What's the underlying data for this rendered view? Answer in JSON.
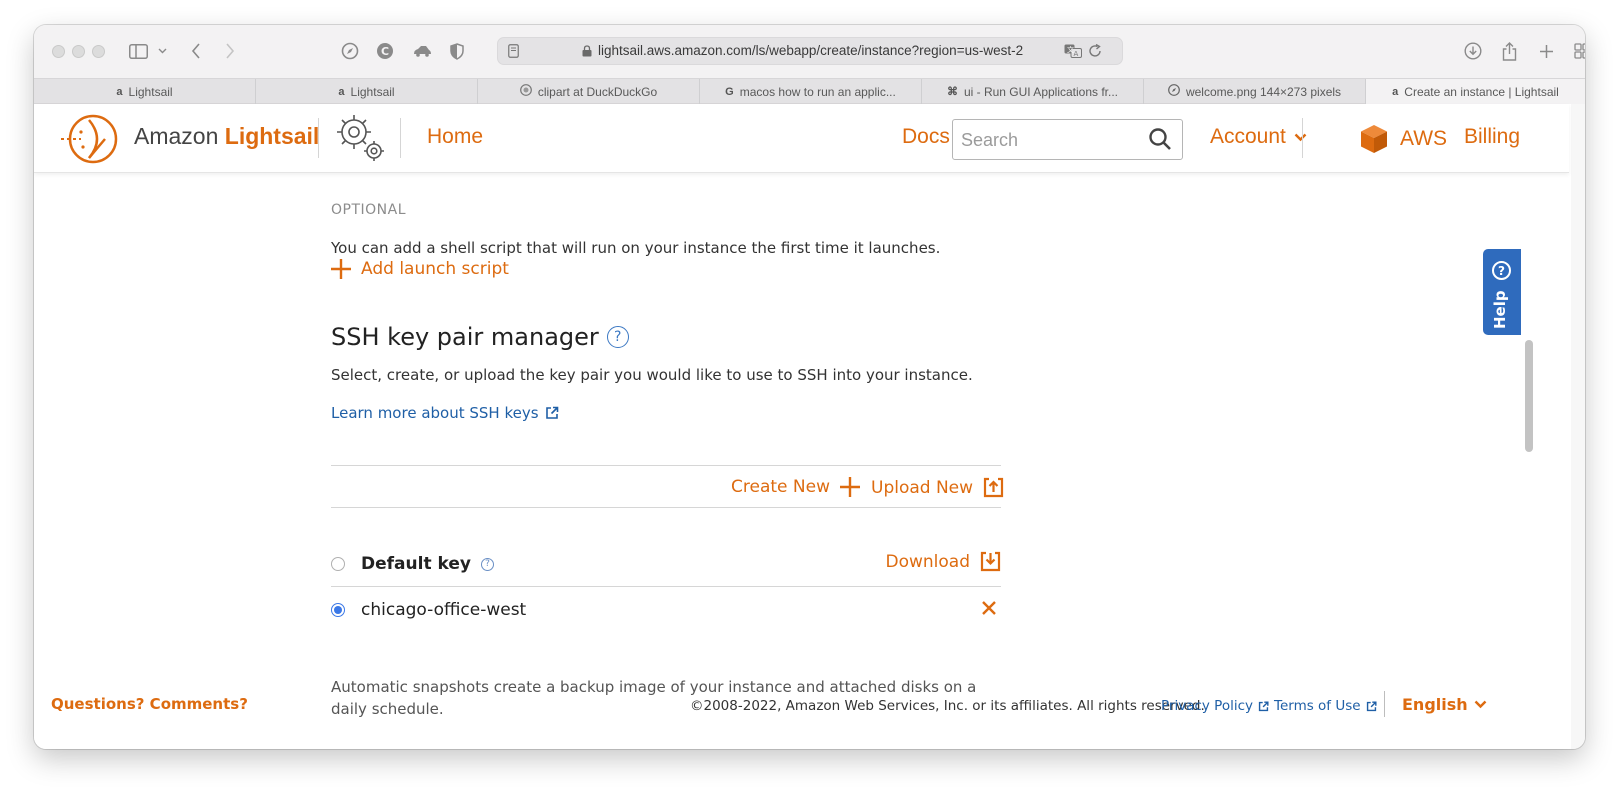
{
  "browser": {
    "url": "lightsail.aws.amazon.com/ls/webapp/create/instance?region=us-west-2",
    "tabs": [
      {
        "label": "Lightsail",
        "favicon": "a"
      },
      {
        "label": "Lightsail",
        "favicon": "a"
      },
      {
        "label": "clipart at DuckDuckGo",
        "favicon": "duck-icon"
      },
      {
        "label": "macos how to run an applic...",
        "favicon": "G"
      },
      {
        "label": "ui - Run GUI Applications fr...",
        "favicon": "⌘"
      },
      {
        "label": "welcome.png 144×273 pixels",
        "favicon": "compass-icon"
      },
      {
        "label": "Create an instance | Lightsail",
        "favicon": "a",
        "active": true
      }
    ]
  },
  "header": {
    "logo_prefix": "Amazon",
    "logo_brand": "Lightsail",
    "home": "Home",
    "docs": "Docs",
    "search_placeholder": "Search",
    "account": "Account",
    "aws": "AWS",
    "billing": "Billing"
  },
  "launch_script": {
    "optional_label": "OPTIONAL",
    "description": "You can add a shell script that will run on your instance the first time it launches.",
    "add_label": "Add launch script"
  },
  "ssh": {
    "title": "SSH key pair manager",
    "description": "Select, create, or upload the key pair you would like to use to SSH into your instance.",
    "learn_more": "Learn more about SSH keys",
    "create_new": "Create New",
    "upload_new": "Upload New",
    "keys": [
      {
        "name": "Default key",
        "selected": false,
        "action": "Download"
      },
      {
        "name": "chicago-office-west",
        "selected": true
      }
    ]
  },
  "snapshots": {
    "description": "Automatic snapshots create a backup image of your instance and attached disks on a daily schedule."
  },
  "help": {
    "label": "Help"
  },
  "footer": {
    "questions": "Questions? Comments?",
    "copyright": "©2008-2022, Amazon Web Services, Inc. or its affiliates. All rights reserved.",
    "privacy": "Privacy Policy",
    "terms": "Terms of Use",
    "language": "English"
  },
  "colors": {
    "accent": "#dd6b10",
    "link": "#1f5fa6",
    "help_bg": "#2f6bbd",
    "radio_selected": "#3b78e7"
  }
}
